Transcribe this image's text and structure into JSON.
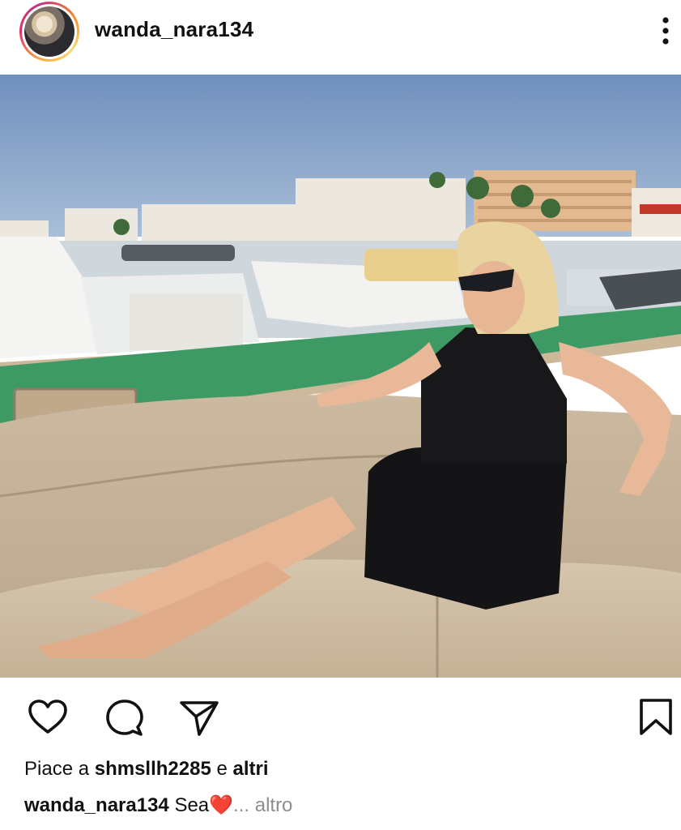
{
  "post": {
    "username": "wanda_nara134",
    "header_icons": {
      "avatar": "profile-avatar",
      "menu": "more-vertical-icon"
    },
    "actions": [
      "heart-icon",
      "comment-icon",
      "share-icon",
      "bookmark-icon"
    ],
    "likes": {
      "prefix": "Piace a ",
      "user": "shmsllh2285",
      "middle": " e ",
      "others": "altri"
    },
    "caption": {
      "username": "wanda_nara134",
      "text": " Sea",
      "emoji": "❤️",
      "ellipsis": "... ",
      "more": "altro"
    }
  },
  "colors": {
    "ring_start": "#f9a53a",
    "ring_end": "#c13584",
    "heart": "#e8112d",
    "muted": "#8e8e8e"
  }
}
